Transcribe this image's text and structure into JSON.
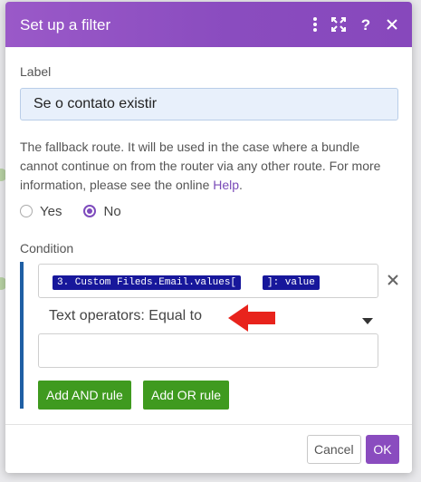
{
  "dialog": {
    "title": "Set up a filter",
    "header_icons": [
      "more-vertical-icon",
      "expand-icon",
      "help-icon",
      "close-icon"
    ]
  },
  "label_field": {
    "caption": "Label",
    "value": "Se o contato existir"
  },
  "fallback": {
    "text": "The fallback route. It will be used in the case where a bundle cannot continue on from the router via any other route. For more information, please see the online",
    "link": "Help",
    "suffix": ".",
    "options": [
      {
        "label": "Yes",
        "checked": false
      },
      {
        "label": "No",
        "checked": true
      }
    ]
  },
  "condition": {
    "caption": "Condition",
    "expression_tokens": [
      "3. Custom Fileds.Email.values[",
      "]: value"
    ],
    "operator": "Text operators: Equal to",
    "value": "",
    "add_and_label": "Add AND rule",
    "add_or_label": "Add OR rule"
  },
  "footer": {
    "cancel_label": "Cancel",
    "ok_label": "OK"
  },
  "colors": {
    "accent": "#8a4cbf",
    "green": "#3f9a1f",
    "token": "#17179b",
    "condition_bar": "#1f5fa4",
    "annotation_arrow": "#e8231c"
  }
}
